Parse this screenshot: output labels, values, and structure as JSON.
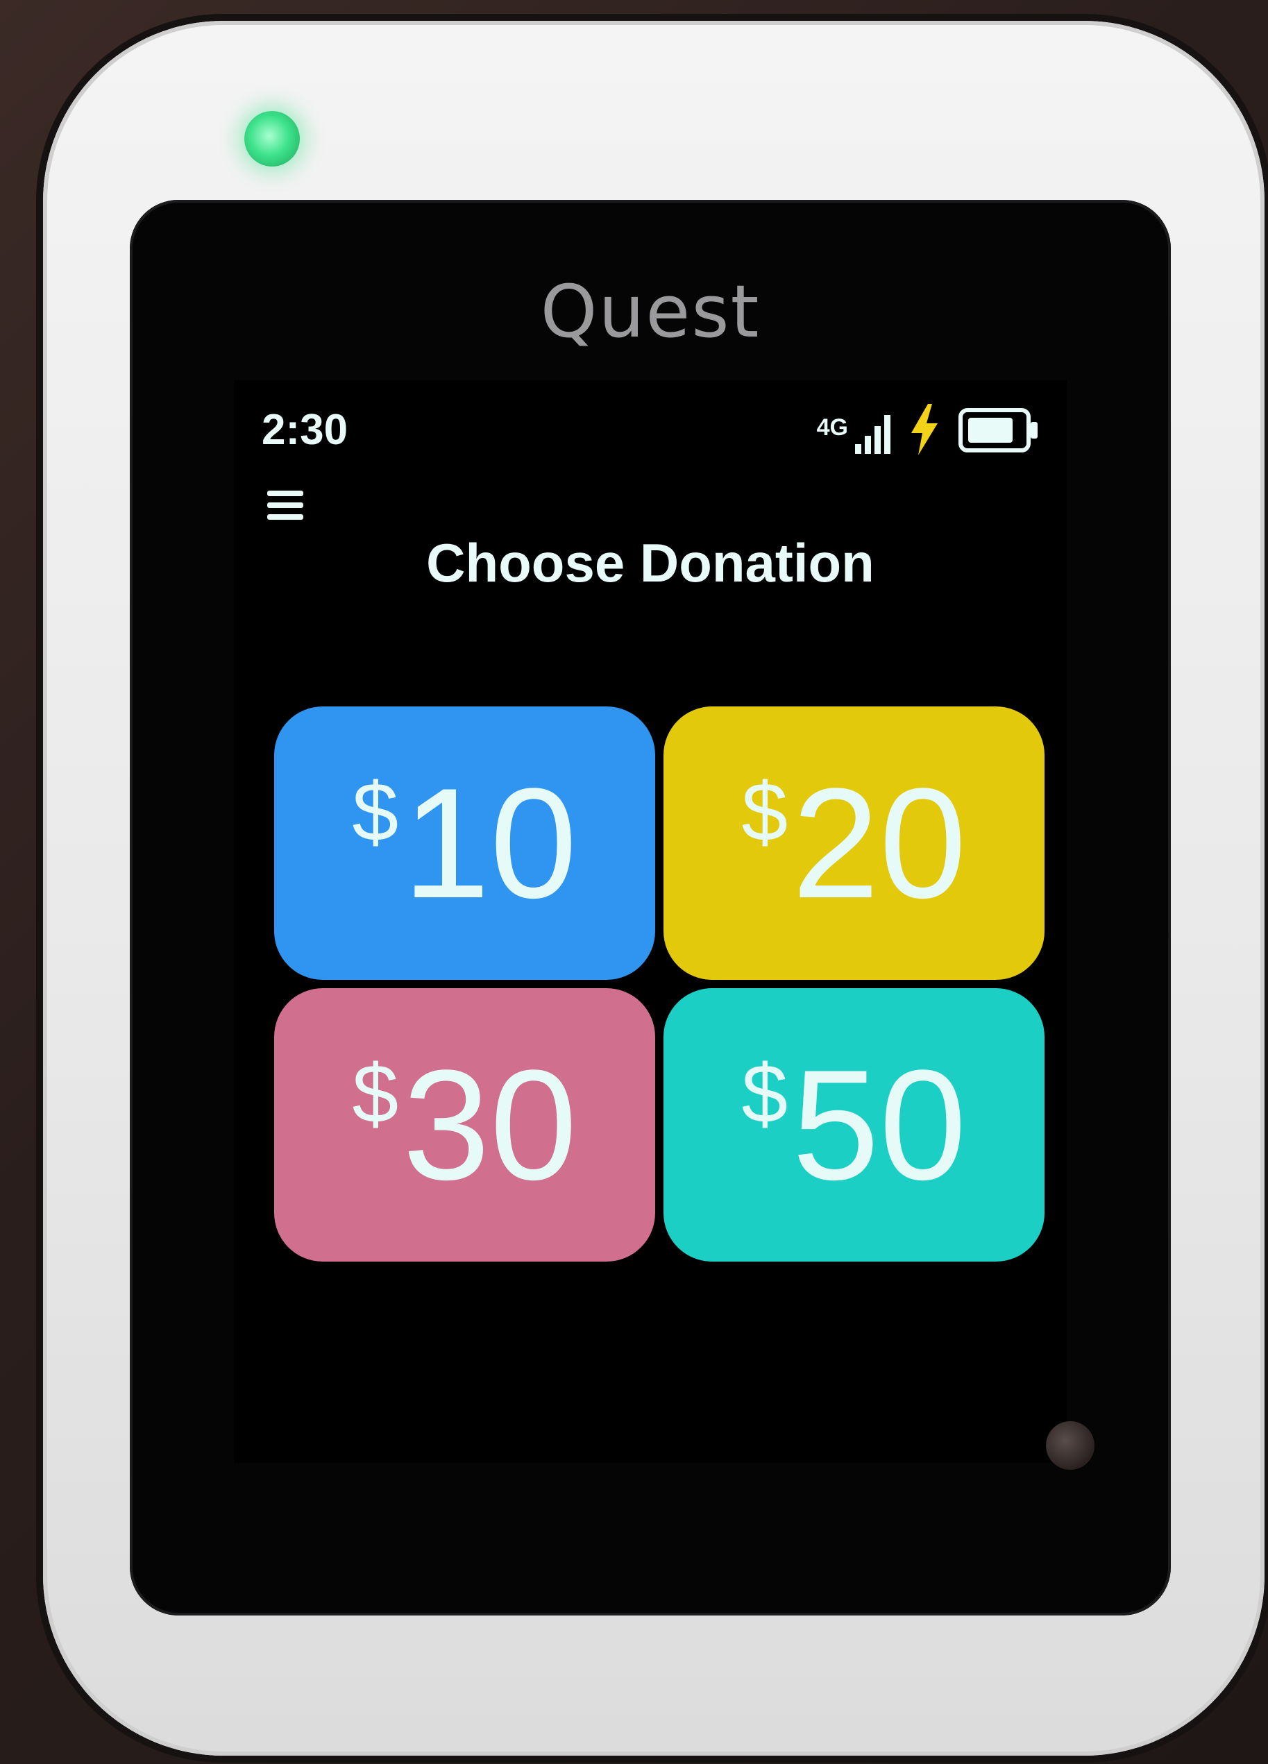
{
  "device": {
    "brand": "Quest",
    "led_color": "#3ee28c"
  },
  "status_bar": {
    "time": "2:30",
    "network": "4G",
    "signal_icon": "signal-bars-icon",
    "charging_icon": "lightning-bolt-icon",
    "battery_icon": "battery-icon",
    "icon_color": "#e8fbf9",
    "charging_color": "#f2d318"
  },
  "header": {
    "menu_icon": "hamburger-menu-icon",
    "title": "Choose Donation"
  },
  "donation_options": [
    {
      "currency": "$",
      "amount": "10",
      "color": "#2f95f0"
    },
    {
      "currency": "$",
      "amount": "20",
      "color": "#e2c90c"
    },
    {
      "currency": "$",
      "amount": "30",
      "color": "#d16f8e"
    },
    {
      "currency": "$",
      "amount": "50",
      "color": "#1ccfc4"
    }
  ]
}
